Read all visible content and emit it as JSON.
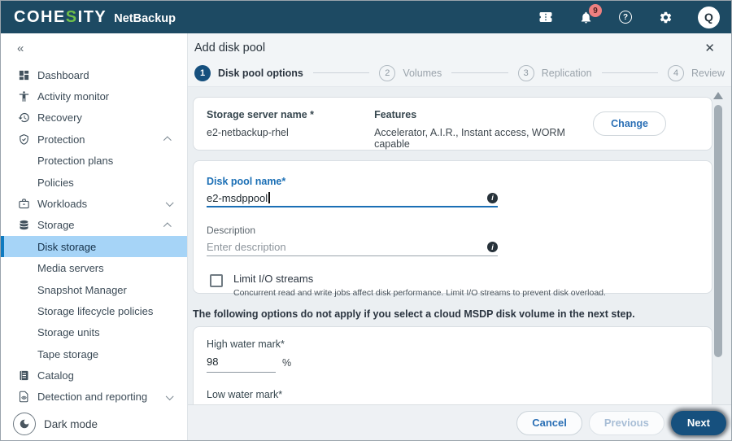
{
  "topbar": {
    "brand_pre": "COHE",
    "brand_s": "S",
    "brand_post": "ITY",
    "product": "NetBackup",
    "notification_count": "9",
    "avatar_letter": "Q"
  },
  "icons": {
    "collapse_glyph": "«",
    "close_glyph": "✕",
    "help_glyph": "?",
    "info_glyph": "i"
  },
  "sidebar": {
    "items": [
      {
        "label": "Dashboard"
      },
      {
        "label": "Activity monitor"
      },
      {
        "label": "Recovery"
      },
      {
        "label": "Protection"
      },
      {
        "label": "Protection plans"
      },
      {
        "label": "Policies"
      },
      {
        "label": "Workloads"
      },
      {
        "label": "Storage"
      },
      {
        "label": "Disk storage"
      },
      {
        "label": "Media servers"
      },
      {
        "label": "Snapshot Manager"
      },
      {
        "label": "Storage lifecycle policies"
      },
      {
        "label": "Storage units"
      },
      {
        "label": "Tape storage"
      },
      {
        "label": "Catalog"
      },
      {
        "label": "Detection and reporting"
      }
    ],
    "dark_mode_label": "Dark mode"
  },
  "wizard": {
    "title": "Add disk pool",
    "steps": [
      {
        "num": "1",
        "label": "Disk pool options"
      },
      {
        "num": "2",
        "label": "Volumes"
      },
      {
        "num": "3",
        "label": "Replication"
      },
      {
        "num": "4",
        "label": "Review"
      }
    ],
    "server_card": {
      "server_label": "Storage server name *",
      "server_value": "e2-netbackup-rhel",
      "features_label": "Features",
      "features_value": "Accelerator, A.I.R., Instant access, WORM capable",
      "change_button": "Change"
    },
    "pool_card": {
      "name_label": "Disk pool name*",
      "name_value": "e2-msdppool",
      "description_label": "Description",
      "description_placeholder": "Enter description",
      "limit_label": "Limit I/O streams",
      "limit_helper": "Concurrent read and write jobs affect disk performance. Limit I/O streams to prevent disk overload."
    },
    "options_note": "The following options do not apply if you select a cloud MSDP disk volume in the next step.",
    "water_card": {
      "high_label": "High water mark*",
      "high_value": "98",
      "high_unit": "%",
      "low_label": "Low water mark*"
    },
    "footer": {
      "cancel_label": "Cancel",
      "previous_label": "Previous",
      "next_label": "Next"
    }
  },
  "colors": {
    "topbar_bg": "#1d4a63",
    "brand_green": "#6fbf4a",
    "accent_blue": "#1b6fb5",
    "active_step_bg": "#16507e",
    "selected_item_bg": "#a6d4f7",
    "selected_item_border": "#0e7ac0",
    "badge_bg": "#ee8080",
    "next_button_bg": "#16507e"
  }
}
